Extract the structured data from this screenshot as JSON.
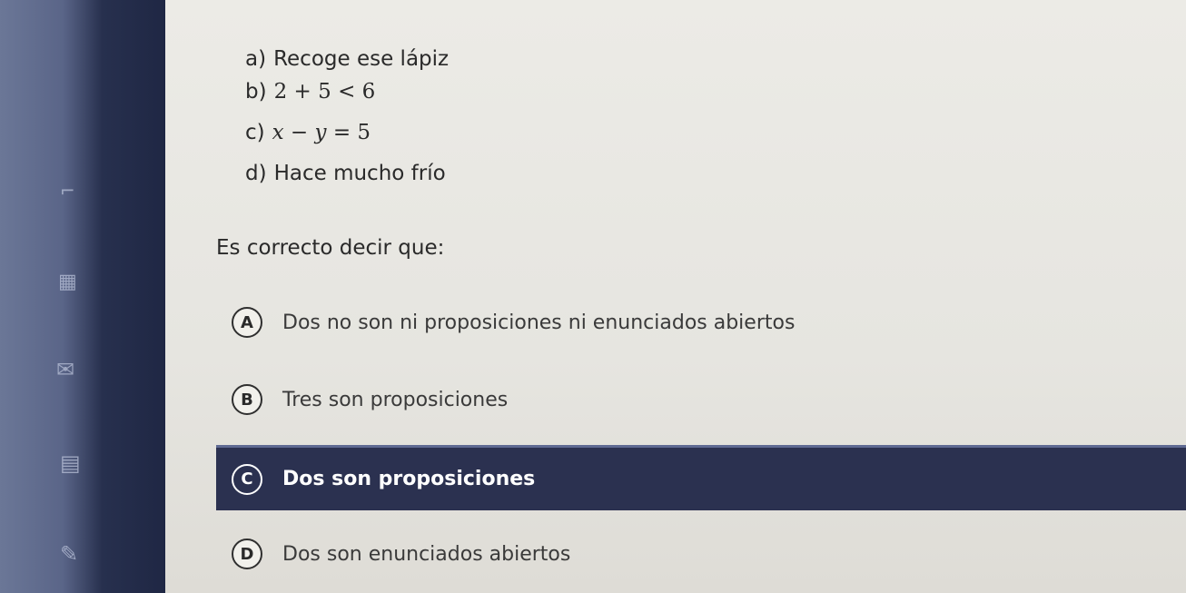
{
  "statements": [
    {
      "label": "a)",
      "text": "Recoge ese lápiz"
    },
    {
      "label": "b)",
      "math": {
        "lhs": "2 + 5",
        "op": "<",
        "rhs": "6"
      }
    },
    {
      "label": "c)",
      "math": {
        "v1": "x",
        "minus": "−",
        "v2": "y",
        "eq": "=",
        "rhs": "5"
      }
    },
    {
      "label": "d)",
      "text": "Hace mucho frío"
    }
  ],
  "question": "Es correcto decir que:",
  "options": [
    {
      "letter": "A",
      "text": "Dos no son ni proposiciones ni enunciados abiertos",
      "selected": false
    },
    {
      "letter": "B",
      "text": "Tres son proposiciones",
      "selected": false
    },
    {
      "letter": "C",
      "text": "Dos son proposiciones",
      "selected": true
    },
    {
      "letter": "D",
      "text": "Dos son enunciados abiertos",
      "selected": false
    }
  ],
  "sidebar_icons": [
    "bookmark-icon",
    "calculator-icon",
    "mail-icon",
    "document-icon",
    "edit-icon"
  ],
  "colors": {
    "selected_background": "#2b3150",
    "selected_text": "#ffffff",
    "sidebar": "#27304e",
    "page_background": "#e9e8e4"
  }
}
